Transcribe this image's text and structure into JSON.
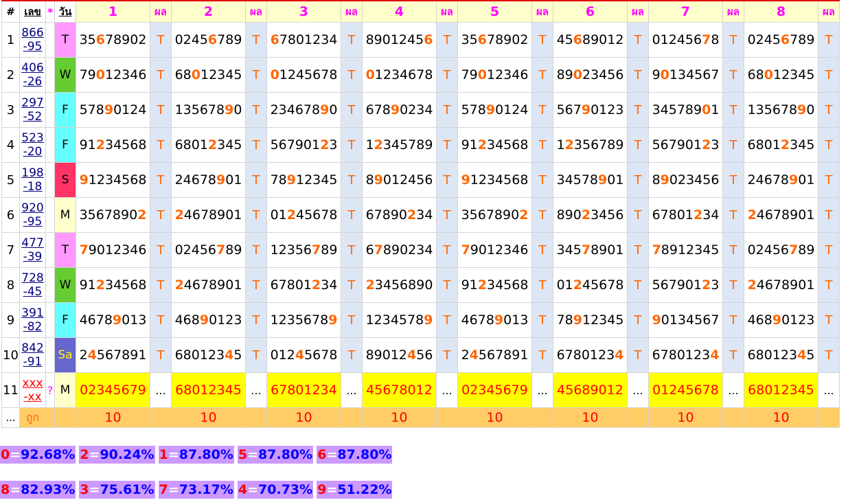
{
  "header": {
    "hash": "#",
    "lek": "เลข",
    "star": "*",
    "wan": "วัน",
    "columns": [
      "1",
      "2",
      "3",
      "4",
      "5",
      "6",
      "7",
      "8"
    ],
    "pon": "ผล"
  },
  "rows": [
    {
      "idx": "1",
      "lek_top": "866",
      "lek_bot": "-95",
      "day": "T",
      "day_color": "#ff99ff",
      "cells": [
        [
          "35",
          "6",
          "78902"
        ],
        [
          "0245",
          "6",
          "789"
        ],
        [
          "",
          "6",
          "7801234"
        ],
        [
          "8901245",
          "6",
          ""
        ],
        [
          "35",
          "6",
          "78902"
        ],
        [
          "45",
          "6",
          "89012"
        ],
        [
          "012456",
          "7",
          "8"
        ],
        [
          "0245",
          "6",
          "789"
        ]
      ],
      "results": [
        "T",
        "T",
        "T",
        "T",
        "T",
        "T",
        "T",
        "T"
      ]
    },
    {
      "idx": "2",
      "lek_top": "406",
      "lek_bot": "-26",
      "day": "W",
      "day_color": "#66cc33",
      "cells": [
        [
          "79",
          "0",
          "12346"
        ],
        [
          "68",
          "0",
          "12345"
        ],
        [
          "",
          "0",
          "1245678"
        ],
        [
          "",
          "0",
          "1234678"
        ],
        [
          "79",
          "0",
          "12346"
        ],
        [
          "89",
          "0",
          "23456"
        ],
        [
          "9",
          "0",
          "134567"
        ],
        [
          "68",
          "0",
          "12345"
        ]
      ],
      "results": [
        "T",
        "T",
        "T",
        "T",
        "T",
        "T",
        "T",
        "T"
      ]
    },
    {
      "idx": "3",
      "lek_top": "297",
      "lek_bot": "-52",
      "day": "F",
      "day_color": "#66ffff",
      "cells": [
        [
          "578",
          "9",
          "0124"
        ],
        [
          "135678",
          "9",
          "0"
        ],
        [
          "234678",
          "9",
          "0"
        ],
        [
          "678",
          "9",
          "0234"
        ],
        [
          "578",
          "9",
          "0124"
        ],
        [
          "567",
          "9",
          "0123"
        ],
        [
          "345789",
          "0",
          "1"
        ],
        [
          "135678",
          "9",
          "0"
        ]
      ],
      "results": [
        "T",
        "T",
        "T",
        "T",
        "T",
        "T",
        "T",
        "T"
      ]
    },
    {
      "idx": "4",
      "lek_top": "523",
      "lek_bot": "-20",
      "day": "F",
      "day_color": "#66ffff",
      "cells": [
        [
          "91",
          "2",
          "34568"
        ],
        [
          "6801",
          "2",
          "345"
        ],
        [
          "567901",
          "2",
          "3"
        ],
        [
          "1",
          "2",
          "345789"
        ],
        [
          "91",
          "2",
          "34568"
        ],
        [
          "1",
          "2",
          "356789"
        ],
        [
          "567901",
          "2",
          "3"
        ],
        [
          "6801",
          "2",
          "345"
        ]
      ],
      "results": [
        "T",
        "T",
        "T",
        "T",
        "T",
        "T",
        "T",
        "T"
      ]
    },
    {
      "idx": "5",
      "lek_top": "198",
      "lek_bot": "-18",
      "day": "S",
      "day_color": "#ff3366",
      "cells": [
        [
          "",
          "9",
          "1234568"
        ],
        [
          "24678",
          "9",
          "01"
        ],
        [
          "78",
          "9",
          "12345"
        ],
        [
          "8",
          "9",
          "012456"
        ],
        [
          "",
          "9",
          "1234568"
        ],
        [
          "34578",
          "9",
          "01"
        ],
        [
          "8",
          "9",
          "023456"
        ],
        [
          "24678",
          "9",
          "01"
        ]
      ],
      "results": [
        "T",
        "T",
        "T",
        "T",
        "T",
        "T",
        "T",
        "T"
      ]
    },
    {
      "idx": "6",
      "lek_top": "920",
      "lek_bot": "-95",
      "day": "M",
      "day_color": "#ffffcc",
      "cells": [
        [
          "3567890",
          "2",
          ""
        ],
        [
          "",
          "2",
          "4678901"
        ],
        [
          "01",
          "2",
          "45678"
        ],
        [
          "67890",
          "2",
          "34"
        ],
        [
          "3567890",
          "2",
          ""
        ],
        [
          "890",
          "2",
          "3456"
        ],
        [
          "67801",
          "2",
          "34"
        ],
        [
          "",
          "2",
          "4678901"
        ]
      ],
      "results": [
        "T",
        "T",
        "T",
        "T",
        "T",
        "T",
        "T",
        "T"
      ]
    },
    {
      "idx": "7",
      "lek_top": "477",
      "lek_bot": "-39",
      "day": "T",
      "day_color": "#ff99ff",
      "cells": [
        [
          "",
          "7",
          "9012346"
        ],
        [
          "02456",
          "7",
          "89"
        ],
        [
          "12356",
          "7",
          "89"
        ],
        [
          "6",
          "7",
          "890234"
        ],
        [
          "",
          "7",
          "9012346"
        ],
        [
          "345",
          "7",
          "8901"
        ],
        [
          "",
          "7",
          "8912345"
        ],
        [
          "02456",
          "7",
          "89"
        ]
      ],
      "results": [
        "T",
        "T",
        "T",
        "T",
        "T",
        "T",
        "T",
        "T"
      ]
    },
    {
      "idx": "8",
      "lek_top": "728",
      "lek_bot": "-45",
      "day": "W",
      "day_color": "#66cc33",
      "cells": [
        [
          "91",
          "2",
          "34568"
        ],
        [
          "",
          "2",
          "4678901"
        ],
        [
          "67801",
          "2",
          "34"
        ],
        [
          "",
          "2",
          "3456890"
        ],
        [
          "91",
          "2",
          "34568"
        ],
        [
          "01",
          "2",
          "45678"
        ],
        [
          "567901",
          "2",
          "3"
        ],
        [
          "",
          "2",
          "4678901"
        ]
      ],
      "results": [
        "T",
        "T",
        "T",
        "T",
        "T",
        "T",
        "T",
        "T"
      ]
    },
    {
      "idx": "9",
      "lek_top": "391",
      "lek_bot": "-82",
      "day": "F",
      "day_color": "#66ffff",
      "cells": [
        [
          "4678",
          "9",
          "013"
        ],
        [
          "468",
          "9",
          "0123"
        ],
        [
          "1235678",
          "9",
          ""
        ],
        [
          "1234578",
          "9",
          ""
        ],
        [
          "4678",
          "9",
          "013"
        ],
        [
          "78",
          "9",
          "12345"
        ],
        [
          "",
          "9",
          "0134567"
        ],
        [
          "468",
          "9",
          "0123"
        ]
      ],
      "results": [
        "T",
        "T",
        "T",
        "T",
        "T",
        "T",
        "T",
        "T"
      ]
    },
    {
      "idx": "10",
      "lek_top": "842",
      "lek_bot": "-91",
      "day": "Sa",
      "day_color": "#6666cc",
      "cells": [
        [
          "2",
          "4",
          "567891"
        ],
        [
          "680123",
          "4",
          "5"
        ],
        [
          "012",
          "4",
          "5678"
        ],
        [
          "89012",
          "4",
          "56"
        ],
        [
          "2",
          "4",
          "567891"
        ],
        [
          "6780123",
          "4",
          ""
        ],
        [
          "6780123",
          "4",
          ""
        ],
        [
          "680123",
          "4",
          "5"
        ]
      ],
      "results": [
        "T",
        "T",
        "T",
        "T",
        "T",
        "T",
        "T",
        "T"
      ]
    }
  ],
  "summary": {
    "idx": "11",
    "lek_top": "xxx",
    "lek_bot": "-xx",
    "q": "?",
    "day": "M",
    "values": [
      "02345679",
      "68012345",
      "67801234",
      "45678012",
      "02345679",
      "45689012",
      "01245678",
      "68012345"
    ],
    "dots": "..."
  },
  "counts": {
    "dots": "...",
    "label": "ถูก",
    "values": [
      "10",
      "10",
      "10",
      "10",
      "10",
      "10",
      "10",
      "10"
    ]
  },
  "stats_row1": [
    {
      "digit": "0",
      "eq": "=",
      "pct": "92.68%"
    },
    {
      "digit": "2",
      "eq": "=",
      "pct": "90.24%"
    },
    {
      "digit": "1",
      "eq": "=",
      "pct": "87.80%"
    },
    {
      "digit": "5",
      "eq": "=",
      "pct": "87.80%"
    },
    {
      "digit": "6",
      "eq": "=",
      "pct": "87.80%"
    }
  ],
  "stats_row2": [
    {
      "digit": "8",
      "eq": "=",
      "pct": "82.93%"
    },
    {
      "digit": "3",
      "eq": "=",
      "pct": "75.61%"
    },
    {
      "digit": "7",
      "eq": "=",
      "pct": "73.17%"
    },
    {
      "digit": "4",
      "eq": "=",
      "pct": "70.73%"
    },
    {
      "digit": "9",
      "eq": "=",
      "pct": "51.22%"
    }
  ]
}
